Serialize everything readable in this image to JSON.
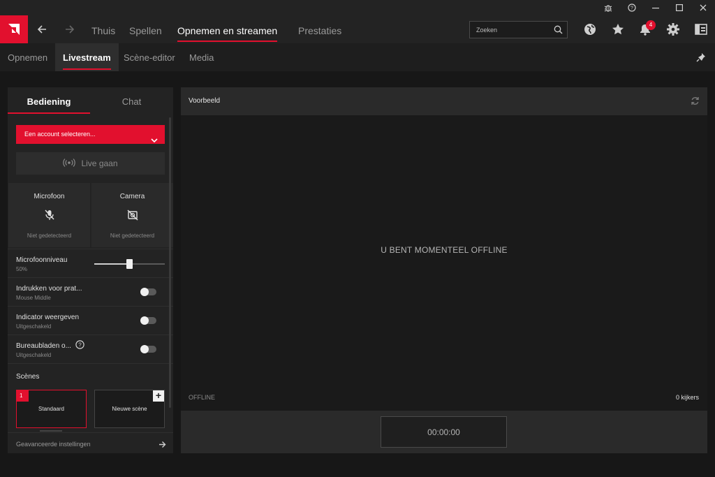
{
  "colors": {
    "accent": "#e2102e",
    "background": "#171717",
    "panel": "#232323"
  },
  "titlebar": {
    "icons": [
      "bug-icon",
      "help-icon",
      "minimize-icon",
      "maximize-icon",
      "close-icon"
    ]
  },
  "nav": {
    "items": [
      "Thuis",
      "Spellen",
      "Opnemen en streamen",
      "Prestaties"
    ],
    "active": "Opnemen en streamen",
    "search_placeholder": "Zoeken",
    "notification_count": "4",
    "icons": [
      "globe-icon",
      "star-icon",
      "bell-icon",
      "gear-icon",
      "sidebar-toggle-icon"
    ]
  },
  "subnav": {
    "items": [
      "Opnemen",
      "Livestream",
      "Scène-editor",
      "Media"
    ],
    "active": "Livestream"
  },
  "panel": {
    "tabs": [
      "Bediening",
      "Chat"
    ],
    "account_select": "Een account selecteren...",
    "live_button": "Live gaan",
    "microphone": {
      "title": "Microfoon",
      "status": "Niet gedetecteerd"
    },
    "camera": {
      "title": "Camera",
      "status": "Niet gedetecteerd"
    },
    "mic_level": {
      "title": "Microfoonniveau",
      "value_label": "50%",
      "value": 0.5
    },
    "push_to_talk": {
      "title": "Indrukken voor prat...",
      "sub": "Mouse Middle",
      "enabled": false
    },
    "indicator": {
      "title": "Indicator weergeven",
      "sub": "Uitgeschakeld",
      "enabled": false
    },
    "desktop": {
      "title": "Bureaubladen o...",
      "sub": "Uitgeschakeld",
      "enabled": false
    },
    "scenes_label": "Scènes",
    "scenes": [
      {
        "number": "1",
        "name": "Standaard"
      },
      {
        "name": "Nieuwe scène"
      }
    ],
    "advanced": "Geavanceerde instellingen"
  },
  "preview": {
    "title": "Voorbeeld",
    "offline_message": "U BENT MOMENTEEL OFFLINE",
    "status": "OFFLINE",
    "viewers": "0 kijkers",
    "timer": "00:00:00"
  }
}
